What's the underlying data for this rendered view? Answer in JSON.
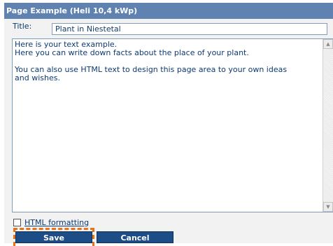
{
  "dialog": {
    "title": "Page Example (Heli 10,4 kWp)"
  },
  "form": {
    "title_label": "Title:",
    "title_value": "Plant in Niestetal",
    "body_text": "Here is your text example.\nHere you can write down facts about the place of your plant.\n\nYou can also use HTML text to design this page area to your own ideas\nand wishes.",
    "html_formatting_label": "HTML formatting",
    "html_formatting_checked": false
  },
  "buttons": {
    "save": "Save",
    "cancel": "Cancel"
  },
  "icons": {
    "scroll_up": "triangle-up-icon",
    "scroll_down": "triangle-down-icon"
  },
  "colors": {
    "titlebar": "#5f82b0",
    "button": "#1d4d86",
    "focus": "#e8741a"
  }
}
